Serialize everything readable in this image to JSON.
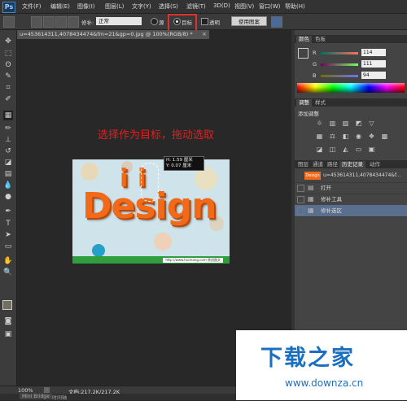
{
  "app": {
    "logo": "Ps"
  },
  "menu": [
    "文件(F)",
    "编辑(E)",
    "图像(I)",
    "图层(L)",
    "文字(Y)",
    "选择(S)",
    "滤镜(T)",
    "3D(D)",
    "视图(V)",
    "窗口(W)",
    "帮助(H)"
  ],
  "options": {
    "repair_label": "修补:",
    "mode_value": "正常",
    "source_label": "源",
    "target_label": "目标",
    "transparent_label": "透明",
    "use_pattern_button": "使用图案"
  },
  "document": {
    "tab_title": "u=453614311,4078434474&fm=21&gp=0.jpg @ 100%(RGB/8)",
    "tab_modified": "*",
    "close": "×"
  },
  "instruction_text": "选择作为目标，拖动选取",
  "image": {
    "letters": "Design",
    "measure_line1": "H: 1.59 厘米",
    "measure_line2": "Y: 0.07 厘米",
    "url_strip": "http://www.huimang.com 原创图文"
  },
  "status": {
    "zoom": "100%",
    "doc_info": "文档:217.2K/217.2K"
  },
  "bottom_tabs": [
    "Mini Bridge",
    "时间轴"
  ],
  "color_panel": {
    "tabs": [
      "颜色",
      "色板"
    ],
    "r": {
      "label": "R",
      "value": "114"
    },
    "g": {
      "label": "G",
      "value": "111"
    },
    "b": {
      "label": "B",
      "value": "94"
    },
    "fg_color": "#726f5e"
  },
  "adjust_panel": {
    "tabs": [
      "调整",
      "样式"
    ],
    "title": "添加调整"
  },
  "history_panel": {
    "tabs": [
      "图层",
      "通道",
      "路径",
      "历史记录",
      "动作"
    ],
    "snapshot": "u=453614311,4078434474&f...",
    "items": [
      "打开",
      "修补工具",
      "修补选区"
    ]
  },
  "watermark": {
    "title": "下载之家",
    "url": "www.downza.cn"
  }
}
